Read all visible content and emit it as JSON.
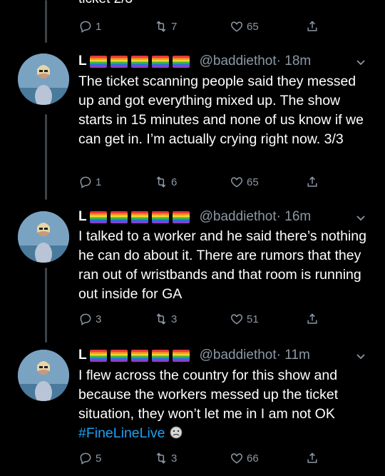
{
  "top_partial": {
    "cut_text": "ticket 2/3",
    "reply_count": "1",
    "retweet_count": "7",
    "like_count": "65"
  },
  "tweets": [
    {
      "display_name": "L",
      "handle": "@baddiethot",
      "time": "· 18m",
      "text": "The ticket scanning people said they messed up and got everything mixed up. The show starts in 15 minutes and none of us know if we can get in. I’m actually crying right now. 3/3",
      "hashtag": "",
      "reply_count": "1",
      "retweet_count": "6",
      "like_count": "65"
    },
    {
      "display_name": "L",
      "handle": "@baddiethot",
      "time": "· 16m",
      "text": "I talked to a worker and he said there’s nothing he can do about it. There are rumors that they ran out of wristbands and that room is running out inside for GA",
      "hashtag": "",
      "reply_count": "3",
      "retweet_count": "3",
      "like_count": "51"
    },
    {
      "display_name": "L",
      "handle": "@baddiethot",
      "time": "· 11m",
      "text": "I flew across the country for this show and because the workers messed up the ticket situation, they won’t let me in I am not OK",
      "hashtag": "#FineLineLive",
      "reply_count": "5",
      "retweet_count": "3",
      "like_count": "66"
    }
  ],
  "colors": {
    "background": "#000000",
    "secondary_text": "#8b98a5",
    "hashtag": "#1da1f2",
    "thread_line": "#3d4246"
  },
  "icons": [
    "reply-icon",
    "retweet-icon",
    "like-icon",
    "share-icon",
    "chevron-down-icon",
    "rainbow-flag-icon"
  ]
}
